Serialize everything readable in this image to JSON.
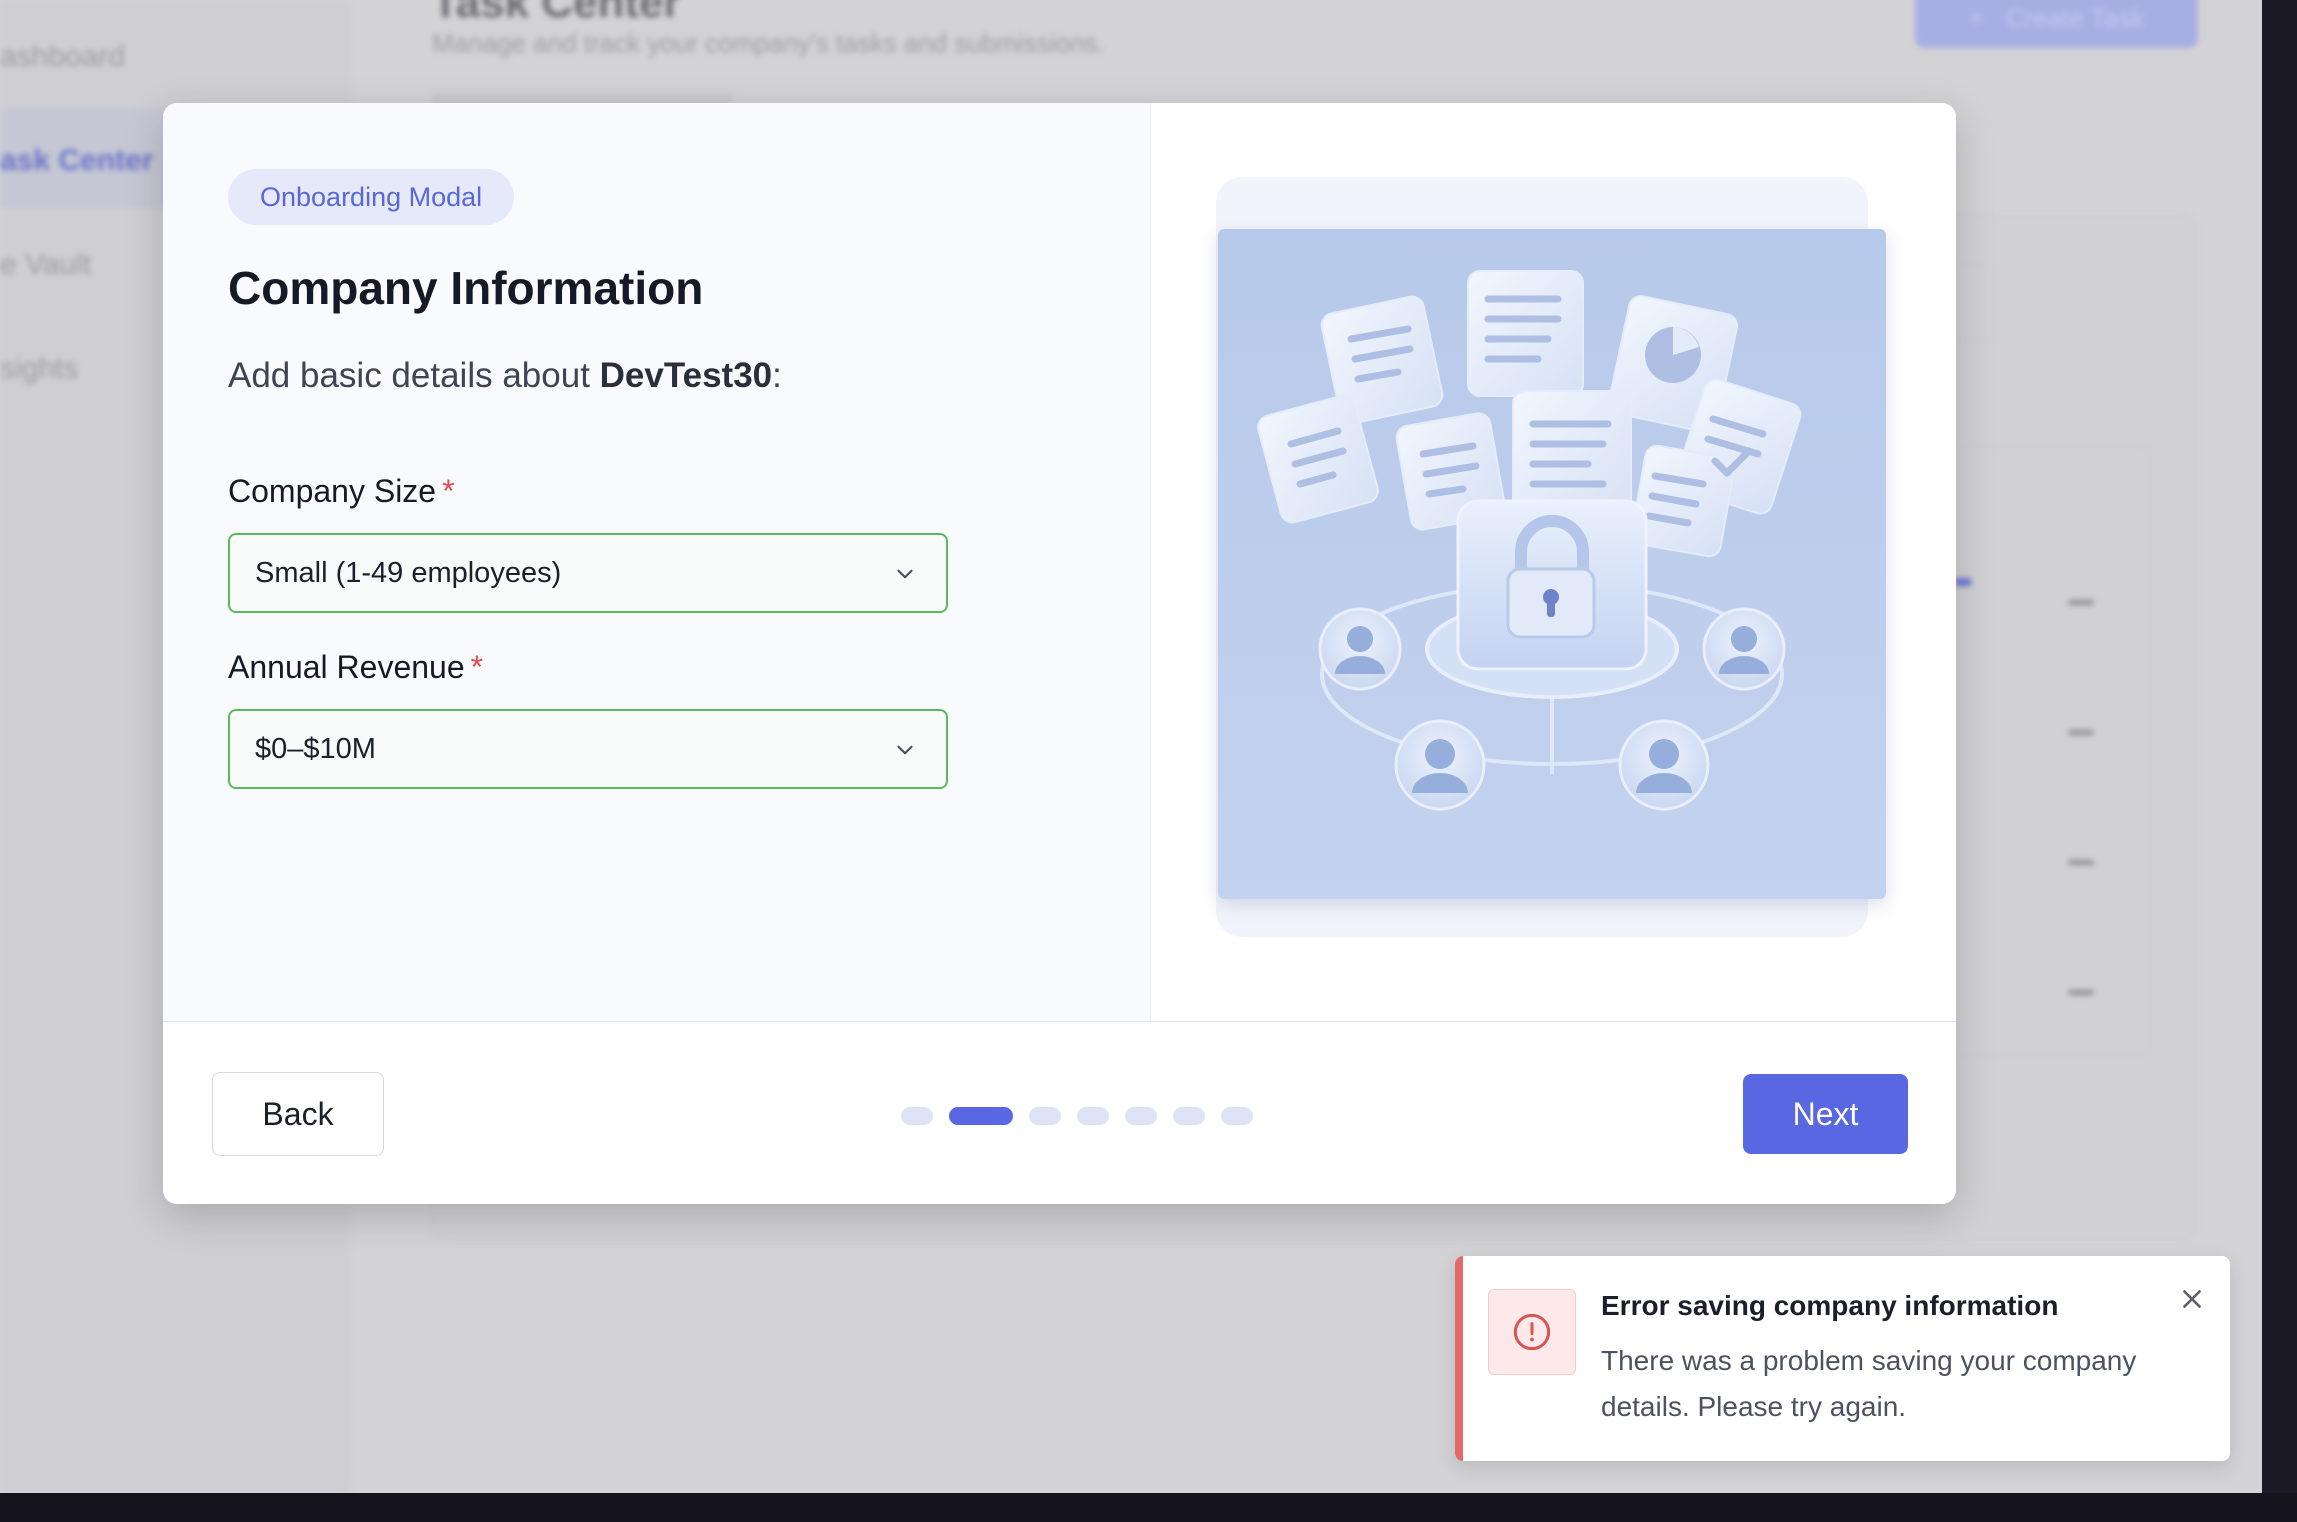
{
  "background": {
    "sidebar": {
      "items": [
        {
          "label": "ashboard"
        },
        {
          "label": "ask Center"
        },
        {
          "label": "e Vault"
        },
        {
          "label": "sights"
        }
      ]
    },
    "header": {
      "title": "Task Center",
      "subtitle": "Manage and track your company's tasks and submissions.",
      "create_button": "Create Task"
    }
  },
  "modal": {
    "badge": "Onboarding Modal",
    "title": "Company Information",
    "subtitle_prefix": "Add basic details about ",
    "company_name": "DevTest30",
    "subtitle_suffix": ":",
    "fields": {
      "company_size": {
        "label": "Company Size",
        "required_mark": "*",
        "value": "Small (1-49 employees)"
      },
      "annual_revenue": {
        "label": "Annual Revenue",
        "required_mark": "*",
        "value": "$0–$10M"
      }
    },
    "footer": {
      "back_label": "Back",
      "next_label": "Next",
      "steps_total": 7,
      "current_step": 2
    }
  },
  "toast": {
    "title": "Error saving company information",
    "message": "There was a problem saving your company details. Please try again.",
    "icon": "alert-circle-icon",
    "close_icon": "close-icon"
  },
  "colors": {
    "accent": "#5a67e3",
    "success_border": "#5cb85c",
    "error": "#e06a6a",
    "required": "#e14b4b"
  }
}
